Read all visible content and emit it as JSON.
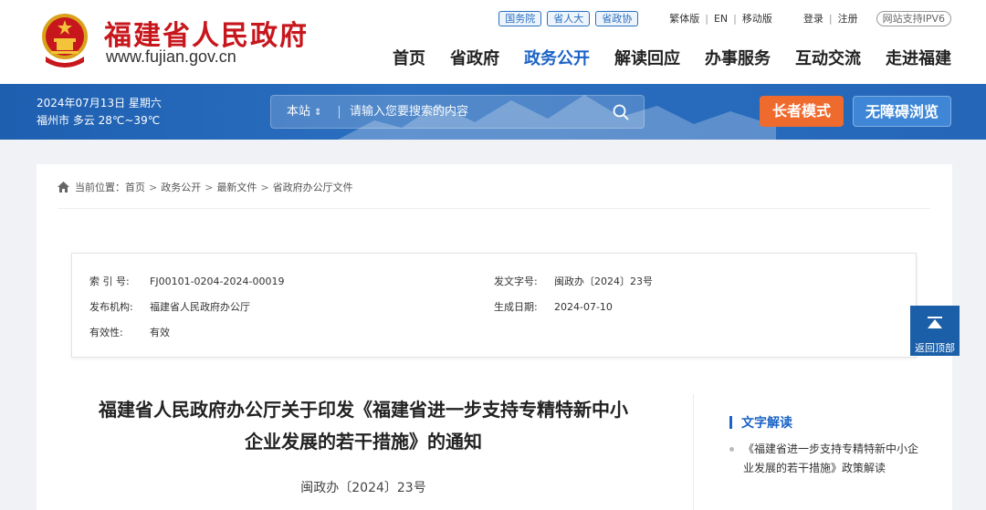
{
  "header": {
    "site_title": "福建省人民政府",
    "site_url": "www.fujian.gov.cn",
    "pills": [
      "国务院",
      "省人大",
      "省政协"
    ],
    "lang_links": [
      "繁体版",
      "EN",
      "移动版"
    ],
    "account_links": [
      "登录",
      "注册"
    ],
    "ipv6_badge": "网站支持IPV6",
    "nav": [
      "首页",
      "省政府",
      "政务公开",
      "解读回应",
      "办事服务",
      "互动交流",
      "走进福建"
    ],
    "active_nav": "政务公开"
  },
  "band": {
    "date_line": "2024年07月13日 星期六",
    "weather_line": "福州市 多云 28℃~39℃",
    "search_scope": "本站",
    "search_placeholder": "请输入您要搜索的内容",
    "elder_mode": "长者模式",
    "accessible_browse": "无障碍浏览"
  },
  "breadcrumb": {
    "prefix": "当前位置：",
    "items": [
      "首页",
      "政务公开",
      "最新文件",
      "省政府办公厅文件"
    ],
    "separator": ">"
  },
  "meta": {
    "index_label": "索 引 号:",
    "index_value": "FJ00101-0204-2024-00019",
    "doc_no_label": "发文字号:",
    "doc_no_value": "闽政办〔2024〕23号",
    "publisher_label": "发布机构:",
    "publisher_value": "福建省人民政府办公厅",
    "date_label": "生成日期:",
    "date_value": "2024-07-10",
    "validity_label": "有效性:",
    "validity_value": "有效"
  },
  "document": {
    "title_line1": "福建省人民政府办公厅关于印发《福建省进一步支持专精特新中小",
    "title_line2": "企业发展的若干措施》的通知",
    "doc_number": "闽政办〔2024〕23号"
  },
  "sidebar": {
    "heading": "文字解读",
    "items": [
      "《福建省进一步支持专精特新中小企业发展的若干措施》政策解读"
    ]
  },
  "back_to_top": "返回顶部",
  "colors": {
    "brand_red": "#c7161c",
    "accent_blue": "#1b63c6",
    "band_blue": "#2566b8",
    "elder_orange": "#ef6a2d"
  }
}
